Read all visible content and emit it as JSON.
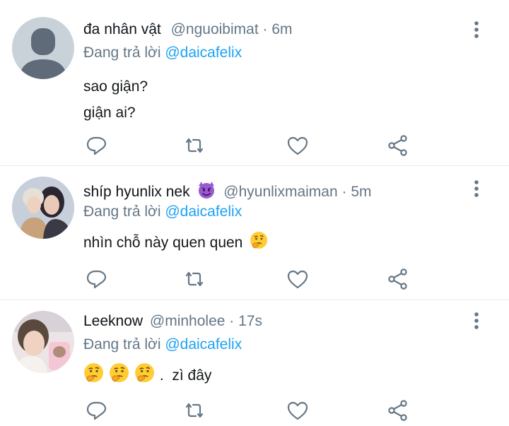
{
  "colors": {
    "accent": "#1da1f2",
    "muted": "#657786",
    "text": "#14171a",
    "divider": "#e6ecf0"
  },
  "icons": {
    "reply": "reply-icon",
    "retweet": "retweet-icon",
    "like": "heart-icon",
    "share": "share-icon",
    "more": "more-vertical-icon"
  },
  "tweets": [
    {
      "name": "đa nhân vật",
      "handle": "@nguoibimat",
      "time": "6m",
      "reply_prefix": "Đang trả lời",
      "reply_to": "@daicafelix",
      "lines": [
        "sao giận?",
        "giận ai?"
      ]
    },
    {
      "name": "shíp hyunlix nek",
      "name_emoji": "smiling-face-with-horns",
      "handle": "@hyunlixmaiman",
      "time": "5m",
      "reply_prefix": "Đang trả lời",
      "reply_to": "@daicafelix",
      "text": "nhìn chỗ này quen quen",
      "text_emoji": "thinking-face"
    },
    {
      "name": "Leeknow",
      "handle": "@minholee",
      "time": "17s",
      "reply_prefix": "Đang trả lời",
      "reply_to": "@daicafelix",
      "text_emojis": [
        "thinking-face",
        "thinking-face",
        "thinking-face"
      ],
      "text": ".  zì đây"
    }
  ],
  "separator": "·"
}
